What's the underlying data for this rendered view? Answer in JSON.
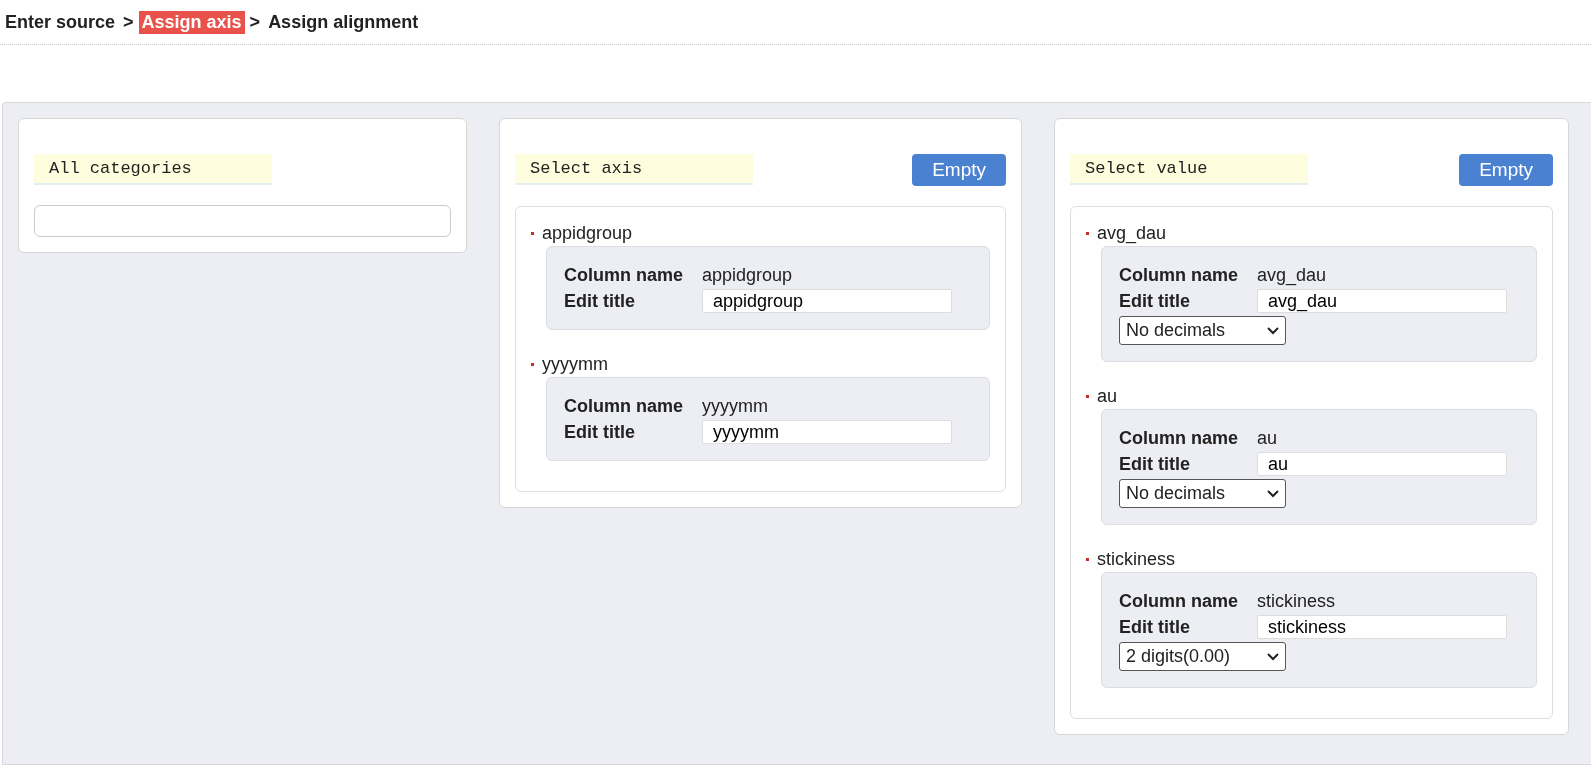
{
  "breadcrumb": [
    {
      "label": "Enter source",
      "selected": false
    },
    {
      "label": "Assign axis",
      "selected": true
    },
    {
      "label": "Assign alignment",
      "selected": false
    }
  ],
  "separators": [
    ">",
    ">"
  ],
  "panels": [
    {
      "title": "All categories",
      "kind": "categories"
    },
    {
      "title": "Select axis",
      "kind": "list",
      "button": "Empty",
      "items": [
        {
          "kind": "axis",
          "name": "appidgroup",
          "column_label": "Column name",
          "column_value": "appidgroup",
          "edit_label": "Edit title",
          "edit_value": "appidgroup"
        },
        {
          "kind": "axis",
          "name": "yyyymm",
          "column_label": "Column name",
          "column_value": "yyyymm",
          "edit_label": "Edit title",
          "edit_value": "yyyymm"
        }
      ]
    },
    {
      "title": "Select value",
      "kind": "list",
      "button": "Empty",
      "items": [
        {
          "kind": "value",
          "name": "avg_dau",
          "column_label": "Column name",
          "column_value": "avg_dau",
          "edit_label": "Edit title",
          "edit_value": "avg_dau",
          "format": "No decimals"
        },
        {
          "kind": "value",
          "name": "au",
          "column_label": "Column name",
          "column_value": "au",
          "edit_label": "Edit title",
          "edit_value": "au",
          "format": "No decimals"
        },
        {
          "kind": "value",
          "name": "stickiness",
          "column_label": "Column name",
          "column_value": "stickiness",
          "edit_label": "Edit title",
          "edit_value": "stickiness",
          "format": "2 digits(0.00)"
        }
      ]
    }
  ]
}
